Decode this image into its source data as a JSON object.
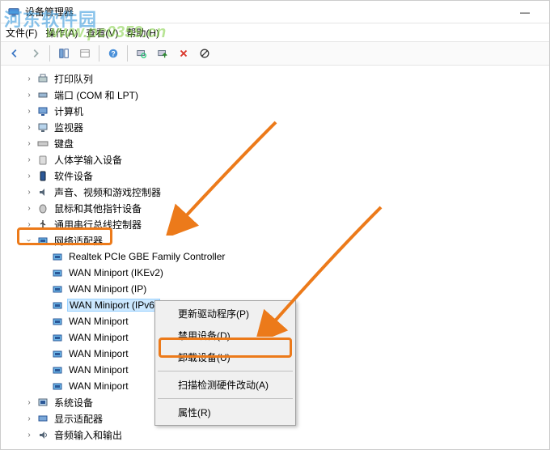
{
  "window": {
    "title": "设备管理器",
    "minimize": "—"
  },
  "menubar": {
    "file": "文件(F)",
    "action": "操作(A)",
    "view": "查看(V)",
    "help": "帮助(H)"
  },
  "tree": {
    "printQueues": "打印队列",
    "ports": "端口 (COM 和 LPT)",
    "computer": "计算机",
    "monitors": "监视器",
    "keyboards": "键盘",
    "hid": "人体学输入设备",
    "software": "软件设备",
    "sound": "声音、视频和游戏控制器",
    "mice": "鼠标和其他指针设备",
    "usb": "通用串行总线控制器",
    "network": "网络适配器",
    "realtek": "Realtek PCIe GBE Family Controller",
    "wanIkev2": "WAN Miniport (IKEv2)",
    "wanIp": "WAN Miniport (IP)",
    "wanIpv6": "WAN Miniport (IPv6)",
    "wanA": "WAN Miniport ",
    "wanB": "WAN Miniport ",
    "wanC": "WAN Miniport ",
    "wanD": "WAN Miniport ",
    "wanE": "WAN Miniport ",
    "system": "系统设备",
    "display": "显示适配器",
    "audio": "音频输入和输出"
  },
  "contextmenu": {
    "updateDriver": "更新驱动程序(P)",
    "disable": "禁用设备(D)",
    "uninstall": "卸载设备(U)",
    "scan": "扫描检测硬件改动(A)",
    "properties": "属性(R)"
  },
  "watermarks": {
    "site": "河东软件园",
    "url": "www.pc0359.cn"
  }
}
